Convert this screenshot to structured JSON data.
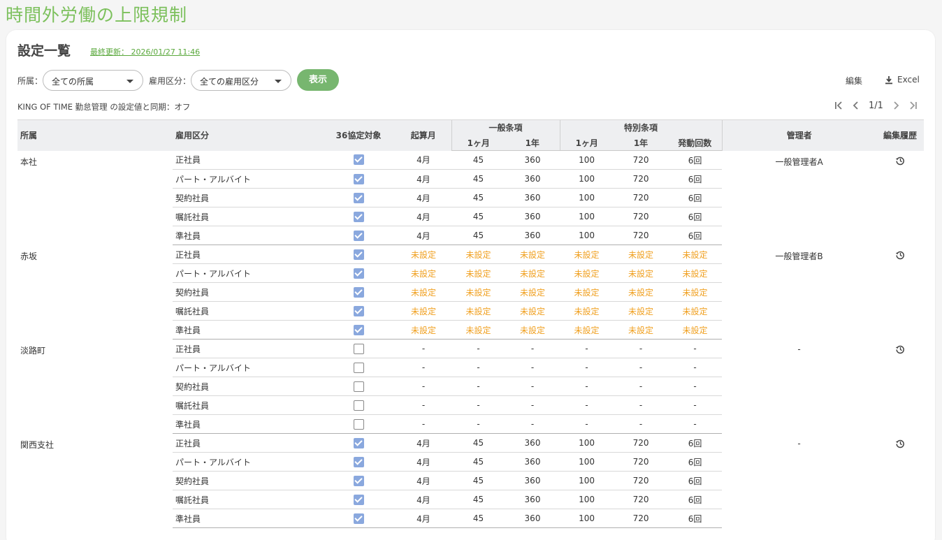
{
  "page": {
    "title": "時間外労働の上限規制"
  },
  "card": {
    "section_title": "設定一覧",
    "last_updated": "最終更新： 2026/01/27 11:46"
  },
  "filters": {
    "dept_label": "所属：",
    "dept_value": "全ての所属",
    "emp_label": "雇用区分：",
    "emp_value": "全ての雇用区分",
    "show_button": "表示"
  },
  "toolbar": {
    "edit_label": "編集",
    "excel_label": "Excel"
  },
  "sync_text": "KING OF TIME 勤怠管理 の設定値と同期：オフ",
  "pager": {
    "text": "1/1"
  },
  "table": {
    "headers": {
      "dept": "所属",
      "emp_type": "雇用区分",
      "target": "36協定対象",
      "start_month": "起算月",
      "general": "一般条項",
      "special": "特別条項",
      "month1": "1ヶ月",
      "year1": "1年",
      "count": "発動回数",
      "manager": "管理者",
      "history": "編集履歴"
    },
    "groups": [
      {
        "dept": "本社",
        "manager": "一般管理者A",
        "history": true,
        "rows": [
          {
            "type": "正社員",
            "checked": true,
            "month": "4月",
            "g1m": "45",
            "g1y": "360",
            "s1m": "100",
            "s1y": "720",
            "cnt": "6回"
          },
          {
            "type": "パート・アルバイト",
            "checked": true,
            "month": "4月",
            "g1m": "45",
            "g1y": "360",
            "s1m": "100",
            "s1y": "720",
            "cnt": "6回"
          },
          {
            "type": "契約社員",
            "checked": true,
            "month": "4月",
            "g1m": "45",
            "g1y": "360",
            "s1m": "100",
            "s1y": "720",
            "cnt": "6回"
          },
          {
            "type": "嘱託社員",
            "checked": true,
            "month": "4月",
            "g1m": "45",
            "g1y": "360",
            "s1m": "100",
            "s1y": "720",
            "cnt": "6回"
          },
          {
            "type": "準社員",
            "checked": true,
            "month": "4月",
            "g1m": "45",
            "g1y": "360",
            "s1m": "100",
            "s1y": "720",
            "cnt": "6回"
          }
        ]
      },
      {
        "dept": "赤坂",
        "manager": "一般管理者B",
        "history": true,
        "rows": [
          {
            "type": "正社員",
            "checked": true,
            "unset": true,
            "month": "未設定",
            "g1m": "未設定",
            "g1y": "未設定",
            "s1m": "未設定",
            "s1y": "未設定",
            "cnt": "未設定"
          },
          {
            "type": "パート・アルバイト",
            "checked": true,
            "unset": true,
            "month": "未設定",
            "g1m": "未設定",
            "g1y": "未設定",
            "s1m": "未設定",
            "s1y": "未設定",
            "cnt": "未設定"
          },
          {
            "type": "契約社員",
            "checked": true,
            "unset": true,
            "month": "未設定",
            "g1m": "未設定",
            "g1y": "未設定",
            "s1m": "未設定",
            "s1y": "未設定",
            "cnt": "未設定"
          },
          {
            "type": "嘱託社員",
            "checked": true,
            "unset": true,
            "month": "未設定",
            "g1m": "未設定",
            "g1y": "未設定",
            "s1m": "未設定",
            "s1y": "未設定",
            "cnt": "未設定"
          },
          {
            "type": "準社員",
            "checked": true,
            "unset": true,
            "month": "未設定",
            "g1m": "未設定",
            "g1y": "未設定",
            "s1m": "未設定",
            "s1y": "未設定",
            "cnt": "未設定"
          }
        ]
      },
      {
        "dept": "淡路町",
        "manager": "-",
        "history": true,
        "rows": [
          {
            "type": "正社員",
            "checked": false,
            "month": "-",
            "g1m": "-",
            "g1y": "-",
            "s1m": "-",
            "s1y": "-",
            "cnt": "-"
          },
          {
            "type": "パート・アルバイト",
            "checked": false,
            "month": "-",
            "g1m": "-",
            "g1y": "-",
            "s1m": "-",
            "s1y": "-",
            "cnt": "-"
          },
          {
            "type": "契約社員",
            "checked": false,
            "month": "-",
            "g1m": "-",
            "g1y": "-",
            "s1m": "-",
            "s1y": "-",
            "cnt": "-"
          },
          {
            "type": "嘱託社員",
            "checked": false,
            "month": "-",
            "g1m": "-",
            "g1y": "-",
            "s1m": "-",
            "s1y": "-",
            "cnt": "-"
          },
          {
            "type": "準社員",
            "checked": false,
            "month": "-",
            "g1m": "-",
            "g1y": "-",
            "s1m": "-",
            "s1y": "-",
            "cnt": "-"
          }
        ]
      },
      {
        "dept": "関西支社",
        "manager": "-",
        "history": true,
        "rows": [
          {
            "type": "正社員",
            "checked": true,
            "month": "4月",
            "g1m": "45",
            "g1y": "360",
            "s1m": "100",
            "s1y": "720",
            "cnt": "6回"
          },
          {
            "type": "パート・アルバイト",
            "checked": true,
            "month": "4月",
            "g1m": "45",
            "g1y": "360",
            "s1m": "100",
            "s1y": "720",
            "cnt": "6回"
          },
          {
            "type": "契約社員",
            "checked": true,
            "month": "4月",
            "g1m": "45",
            "g1y": "360",
            "s1m": "100",
            "s1y": "720",
            "cnt": "6回"
          },
          {
            "type": "嘱託社員",
            "checked": true,
            "month": "4月",
            "g1m": "45",
            "g1y": "360",
            "s1m": "100",
            "s1y": "720",
            "cnt": "6回"
          },
          {
            "type": "準社員",
            "checked": true,
            "month": "4月",
            "g1m": "45",
            "g1y": "360",
            "s1m": "100",
            "s1y": "720",
            "cnt": "6回"
          }
        ]
      }
    ]
  },
  "colors": {
    "title_green": "#7cc05c",
    "button_green": "#77b66f",
    "unset_orange": "#f0a020",
    "checkbox_blue": "#8aa8de"
  },
  "icons": [
    "caret-down-icon",
    "download-icon",
    "first-page-icon",
    "prev-page-icon",
    "next-page-icon",
    "last-page-icon",
    "history-icon",
    "checkbox-icon"
  ]
}
